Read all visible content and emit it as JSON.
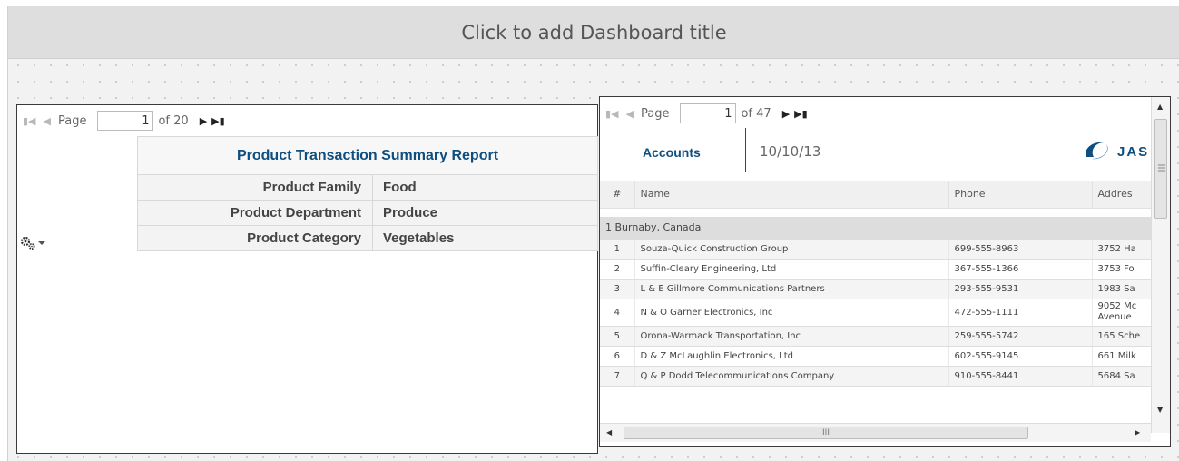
{
  "dashboard": {
    "title": "Click to add Dashboard title"
  },
  "left_dashlet": {
    "pager": {
      "page_label": "Page",
      "current_page": "1",
      "of_label": "of 20"
    },
    "report": {
      "title": "Product Transaction Summary Report",
      "fields": [
        {
          "label": "Product Family",
          "value": "Food"
        },
        {
          "label": "Product Department",
          "value": "Produce"
        },
        {
          "label": "Product Category",
          "value": "Vegetables"
        }
      ]
    },
    "options_icon": "gear-icon"
  },
  "right_dashlet": {
    "pager": {
      "page_label": "Page",
      "current_page": "1",
      "of_label": "of 47"
    },
    "header": {
      "title": "Accounts",
      "date": "10/10/13",
      "logo_text": "JAS"
    },
    "columns": [
      "#",
      "Name",
      "Phone",
      "Addres"
    ],
    "group": {
      "label": "1  Burnaby, Canada"
    },
    "rows": [
      {
        "num": "1",
        "name": "Souza-Quick Construction Group",
        "phone": "699-555-8963",
        "address": "3752 Ha"
      },
      {
        "num": "2",
        "name": "Suffin-Cleary Engineering, Ltd",
        "phone": "367-555-1366",
        "address": "3753 Fo"
      },
      {
        "num": "3",
        "name": "L & E Gillmore Communications Partners",
        "phone": "293-555-9531",
        "address": "1983 Sa"
      },
      {
        "num": "4",
        "name": "N & O Garner Electronics, Inc",
        "phone": "472-555-1111",
        "address": "9052 Mc Avenue"
      },
      {
        "num": "5",
        "name": "Orona-Warmack Transportation, Inc",
        "phone": "259-555-5742",
        "address": "165 Sche"
      },
      {
        "num": "6",
        "name": "D & Z McLaughlin Electronics, Ltd",
        "phone": "602-555-9145",
        "address": "661 Milk"
      },
      {
        "num": "7",
        "name": "Q & P Dodd Telecommunications Company",
        "phone": "910-555-8441",
        "address": "5684 Sa"
      }
    ],
    "hscroll_grip": "III"
  },
  "colors": {
    "accent": "#0f4f7f",
    "title_bar": "#dedede",
    "canvas": "#f2f2f2"
  }
}
